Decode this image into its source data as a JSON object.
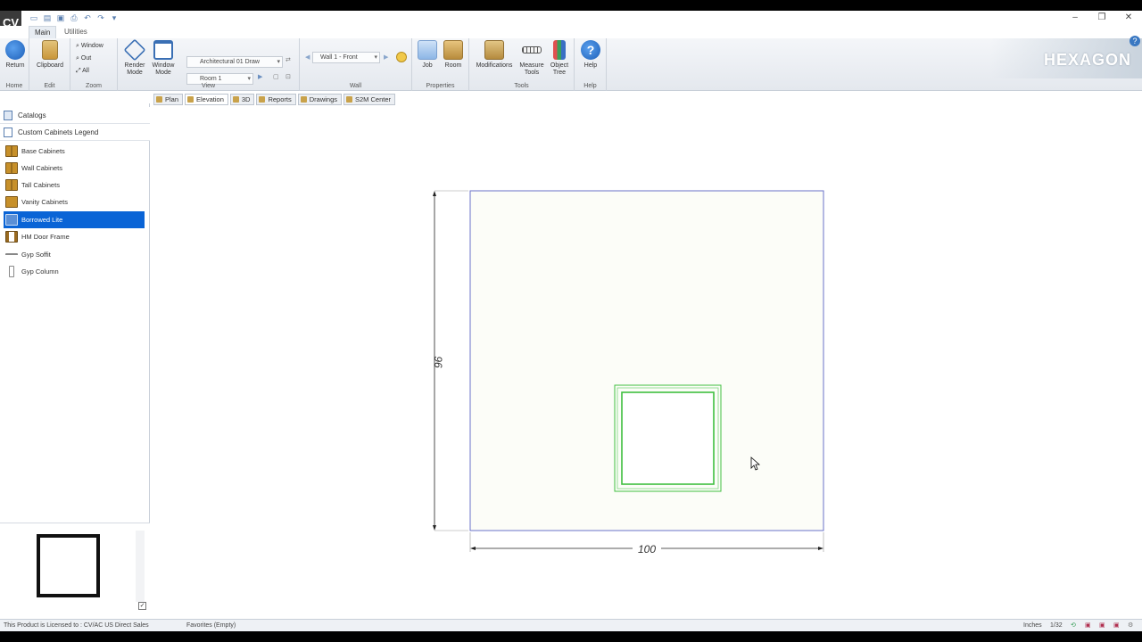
{
  "app": {
    "logo_text": "CV",
    "brand": "HEXAGON",
    "help_badge": "?"
  },
  "ribbon_tabs": [
    {
      "label": "Main",
      "active": true
    },
    {
      "label": "Utilities",
      "active": false
    }
  ],
  "ribbon": {
    "home": {
      "group": "Home",
      "return_label": "Return"
    },
    "edit": {
      "group": "Edit",
      "clipboard_label": "Clipboard"
    },
    "zoom": {
      "group": "Zoom",
      "window_label": "Window",
      "out_label": "Out",
      "all_label": "All"
    },
    "view": {
      "group": "View",
      "render_label": "Render Mode",
      "window_mode_label": "Window Mode",
      "draw_style": "Architectural 01 Draw",
      "room": "Room 1"
    },
    "wall": {
      "group": "Wall",
      "wall_select": "Wall 1 - Front"
    },
    "properties": {
      "group": "Properties",
      "job_label": "Job",
      "room_label": "Room"
    },
    "tools": {
      "group": "Tools",
      "modifications_label": "Modifications",
      "measure_label": "Measure Tools",
      "object_tree_label": "Object Tree"
    },
    "help": {
      "group": "Help",
      "help_label": "Help"
    }
  },
  "sidebar": {
    "catalogs": "Catalogs",
    "legend": "Custom Cabinets Legend",
    "items": [
      {
        "label": "Base Cabinets",
        "icon": "cabinet-icon"
      },
      {
        "label": "Wall Cabinets",
        "icon": "cabinet-icon"
      },
      {
        "label": "Tall Cabinets",
        "icon": "cabinet-icon"
      },
      {
        "label": "Vanity Cabinets",
        "icon": "cabinet-icon"
      },
      {
        "label": "Borrowed Lite",
        "icon": "window-icon",
        "selected": true
      },
      {
        "label": "HM Door Frame",
        "icon": "door-frame-icon"
      },
      {
        "label": "Gyp Soffit",
        "icon": "soffit-icon"
      },
      {
        "label": "Gyp Column",
        "icon": "column-icon"
      }
    ]
  },
  "view_tabs": [
    {
      "label": "Plan",
      "active": false
    },
    {
      "label": "Elevation",
      "active": true
    },
    {
      "label": "3D",
      "active": false
    },
    {
      "label": "Reports",
      "active": false
    },
    {
      "label": "Drawings",
      "active": false
    },
    {
      "label": "S2M Center",
      "active": false
    }
  ],
  "drawing": {
    "wall_height": "96",
    "wall_width": "100"
  },
  "status": {
    "license": "This Product is Licensed to : CV/AC US Direct Sales",
    "favorites": "Favorites (Empty)",
    "units": "Inches",
    "precision": "1/32"
  },
  "colors": {
    "selection": "#0a64d6",
    "lite_outline": "#3fbf3f",
    "wall_outline": "#6a72c8",
    "wall_fill": "#fcfdf8"
  }
}
